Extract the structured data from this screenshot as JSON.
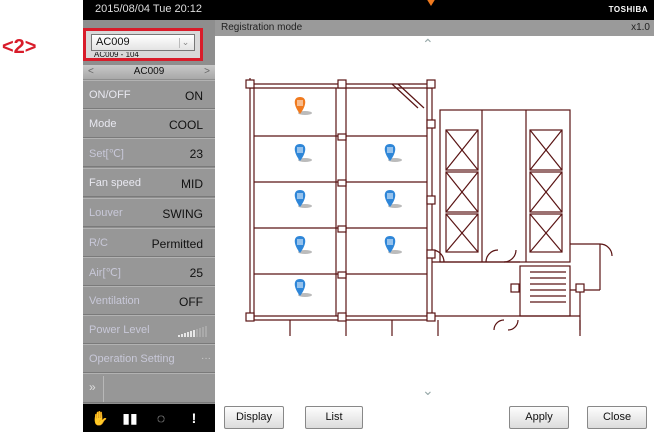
{
  "callout": "<2>",
  "topbar": {
    "datetime": "2015/08/04  Tue  20:12",
    "brand": "TOSHIBA"
  },
  "modebar": {
    "title": "Registration mode",
    "zoom": "x1.0"
  },
  "selector": {
    "value": "AC009",
    "sub": "AC009 - 104"
  },
  "unit_header": {
    "name": "AC009"
  },
  "status": [
    {
      "label": "ON/OFF",
      "value": "ON"
    },
    {
      "label": "Mode",
      "value": "COOL"
    },
    {
      "label": "Set[℃]",
      "value": "23"
    },
    {
      "label": "Fan speed",
      "value": "MID"
    },
    {
      "label": "Louver",
      "value": "SWING"
    },
    {
      "label": "R/C",
      "value": "Permitted"
    },
    {
      "label": "Air[℃]",
      "value": "25"
    },
    {
      "label": "Ventilation",
      "value": "OFF"
    }
  ],
  "power_level": {
    "label": "Power Level",
    "level": 0.6
  },
  "operation_setting": {
    "label": "Operation Setting",
    "ellipsis": "···"
  },
  "expand_arrow": "»",
  "bottom_icons": [
    "hand-icon",
    "book-icon",
    "spinner-icon",
    "alert-icon"
  ],
  "buttons": {
    "display": "Display",
    "list": "List",
    "apply": "Apply",
    "close": "Close"
  },
  "markers": [
    {
      "row": 1,
      "col": 1,
      "color": "#f07a1e"
    },
    {
      "row": 2,
      "col": 1,
      "color": "#2e86d8"
    },
    {
      "row": 2,
      "col": 2,
      "color": "#2e86d8"
    },
    {
      "row": 3,
      "col": 1,
      "color": "#2e86d8"
    },
    {
      "row": 3,
      "col": 2,
      "color": "#2e86d8"
    },
    {
      "row": 4,
      "col": 1,
      "color": "#2e86d8"
    },
    {
      "row": 4,
      "col": 2,
      "color": "#2e86d8"
    },
    {
      "row": 5,
      "col": 1,
      "color": "#2e86d8"
    }
  ],
  "colors": {
    "wall": "#5a1414",
    "selection_border": "#d81c2a",
    "accent_orange": "#f07a1e",
    "marker_blue": "#2e86d8"
  }
}
